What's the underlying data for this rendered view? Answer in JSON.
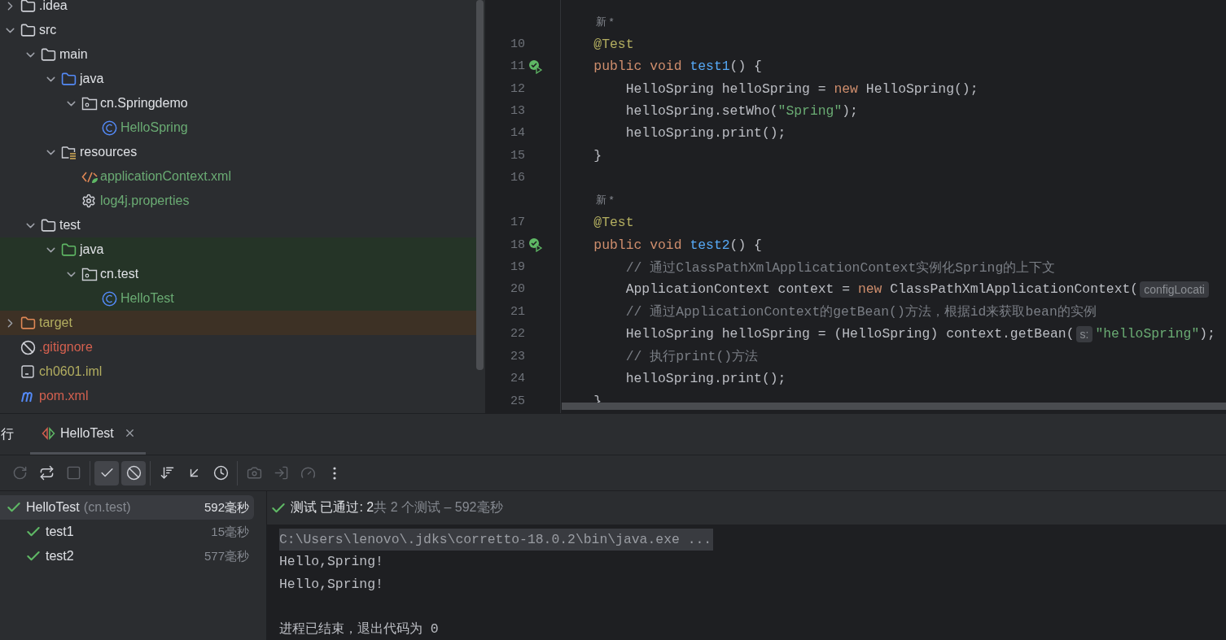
{
  "project_tree": [
    {
      "name": ".idea",
      "kind": "folder",
      "expanded": false,
      "color": "#dfe1e5"
    },
    {
      "name": "src",
      "kind": "folder",
      "expanded": true,
      "color": "#dfe1e5",
      "children": [
        {
          "name": "main",
          "kind": "folder",
          "expanded": true,
          "color": "#dfe1e5",
          "children": [
            {
              "name": "java",
              "kind": "source-folder",
              "expanded": true,
              "color": "#dfe1e5",
              "children": [
                {
                  "name": "cn.Springdemo",
                  "kind": "package",
                  "expanded": true,
                  "color": "#dfe1e5",
                  "children": [
                    {
                      "name": "HelloSpring",
                      "kind": "class",
                      "color": "#6aab73"
                    }
                  ]
                }
              ]
            },
            {
              "name": "resources",
              "kind": "resource-folder",
              "expanded": true,
              "color": "#dfe1e5",
              "children": [
                {
                  "name": "applicationContext.xml",
                  "kind": "xml",
                  "color": "#6aab73"
                },
                {
                  "name": "log4j.properties",
                  "kind": "properties",
                  "color": "#6aab73"
                }
              ]
            }
          ]
        },
        {
          "name": "test",
          "kind": "folder",
          "expanded": true,
          "color": "#dfe1e5",
          "children": [
            {
              "name": "java",
              "kind": "test-folder",
              "expanded": true,
              "color": "#dfe1e5",
              "test_scope": true,
              "children": [
                {
                  "name": "cn.test",
                  "kind": "package",
                  "expanded": true,
                  "color": "#dfe1e5",
                  "test_scope": true,
                  "children": [
                    {
                      "name": "HelloTest",
                      "kind": "class",
                      "color": "#6aab73",
                      "test_scope": true
                    }
                  ]
                }
              ]
            }
          ]
        }
      ]
    },
    {
      "name": "target",
      "kind": "excluded-folder",
      "expanded": false,
      "color": "#b3ae60",
      "excluded": true
    },
    {
      "name": ".gitignore",
      "kind": "ignore",
      "color": "#d3604f"
    },
    {
      "name": "ch0601.iml",
      "kind": "module",
      "color": "#b3ae60"
    },
    {
      "name": "pom.xml",
      "kind": "maven",
      "color": "#d3604f"
    }
  ],
  "editor": {
    "lines": [
      {
        "kind": "hint",
        "text": "新 *"
      },
      {
        "kind": "code",
        "number": "10",
        "segments": [
          {
            "text": "    @Test",
            "kind": "annotation"
          }
        ]
      },
      {
        "kind": "code",
        "number": "11",
        "passed": true,
        "segments": [
          {
            "text": "    public void ",
            "kind": "keyword"
          },
          {
            "text": "test1",
            "kind": "method"
          },
          {
            "text": "() {",
            "kind": "plain"
          }
        ]
      },
      {
        "kind": "code",
        "number": "12",
        "segments": [
          {
            "text": "        HelloSpring helloSpring = ",
            "kind": "plain"
          },
          {
            "text": "new",
            "kind": "keyword"
          },
          {
            "text": " HelloSpring();",
            "kind": "plain"
          }
        ]
      },
      {
        "kind": "code",
        "number": "13",
        "segments": [
          {
            "text": "        helloSpring.setWho(",
            "kind": "plain"
          },
          {
            "text": "\"Spring\"",
            "kind": "string"
          },
          {
            "text": ");",
            "kind": "plain"
          }
        ]
      },
      {
        "kind": "code",
        "number": "14",
        "segments": [
          {
            "text": "        helloSpring.print();",
            "kind": "plain"
          }
        ]
      },
      {
        "kind": "code",
        "number": "15",
        "segments": [
          {
            "text": "    }",
            "kind": "plain"
          }
        ]
      },
      {
        "kind": "code",
        "number": "16"
      },
      {
        "kind": "hint",
        "text": "新 *"
      },
      {
        "kind": "code",
        "number": "17",
        "segments": [
          {
            "text": "    @Test",
            "kind": "annotation"
          }
        ]
      },
      {
        "kind": "code",
        "number": "18",
        "passed": true,
        "segments": [
          {
            "text": "    public void ",
            "kind": "keyword"
          },
          {
            "text": "test2",
            "kind": "method"
          },
          {
            "text": "() {",
            "kind": "plain"
          }
        ]
      },
      {
        "kind": "code",
        "number": "19",
        "segments": [
          {
            "text": "        // 通过ClassPathXmlApplicationContext实例化Spring的上下文",
            "kind": "comment"
          }
        ]
      },
      {
        "kind": "code",
        "number": "20",
        "segments": [
          {
            "text": "        ApplicationContext context = ",
            "kind": "plain"
          },
          {
            "text": "new",
            "kind": "keyword"
          },
          {
            "text": " ClassPathXmlApplicationContext(",
            "kind": "plain"
          },
          {
            "text": "configLocati",
            "kind": "param-hint"
          }
        ]
      },
      {
        "kind": "code",
        "number": "21",
        "segments": [
          {
            "text": "        // 通过ApplicationContext的getBean()方法，根据id来获取bean的实例",
            "kind": "comment"
          }
        ]
      },
      {
        "kind": "code",
        "number": "22",
        "segments": [
          {
            "text": "        HelloSpring helloSpring = (HelloSpring) context.getBean(",
            "kind": "plain"
          },
          {
            "text": "s:",
            "kind": "param-hint"
          },
          {
            "text": "\"helloSpring\"",
            "kind": "string"
          },
          {
            "text": ");",
            "kind": "plain"
          }
        ]
      },
      {
        "kind": "code",
        "number": "23",
        "segments": [
          {
            "text": "        // 执行print()方法",
            "kind": "comment"
          }
        ]
      },
      {
        "kind": "code",
        "number": "24",
        "segments": [
          {
            "text": "        helloSpring.print();",
            "kind": "plain"
          }
        ]
      },
      {
        "kind": "code",
        "number": "25",
        "segments": [
          {
            "text": "    }",
            "kind": "plain"
          }
        ]
      }
    ]
  },
  "run_panel": {
    "title": "行",
    "tabs": [
      {
        "label": "HelloTest",
        "selected": true
      }
    ],
    "toolbar": [
      [
        {
          "selected": false,
          "disabled": true
        },
        {
          "selected": false,
          "disabled": false
        },
        {
          "selected": false,
          "disabled": true
        }
      ],
      [
        {
          "selected": true,
          "disabled": false
        },
        {
          "selected": true,
          "disabled": false
        }
      ],
      [
        {
          "selected": false,
          "disabled": false
        },
        {
          "selected": false,
          "disabled": false
        },
        {
          "selected": false,
          "disabled": false
        }
      ],
      [
        {
          "selected": false,
          "disabled": true
        },
        {
          "selected": false,
          "disabled": true
        },
        {
          "selected": false,
          "disabled": true
        },
        {
          "selected": false,
          "disabled": false
        }
      ]
    ],
    "tests": [
      {
        "name": "HelloTest",
        "package": "(cn.test)",
        "time": "592毫秒",
        "passed": true,
        "selected": true,
        "children": [
          {
            "name": "test1",
            "time": "15毫秒",
            "passed": true,
            "selected": false
          },
          {
            "name": "test2",
            "time": "577毫秒",
            "passed": true,
            "selected": false
          }
        ]
      }
    ],
    "summary": {
      "passed": true,
      "result": "测试 已通过: 2",
      "detail": "共 2 个测试 – 592毫秒"
    },
    "console": [
      {
        "kind": "command",
        "text": "C:\\Users\\lenovo\\.jdks\\corretto-18.0.2\\bin\\java.exe ..."
      },
      {
        "kind": "output",
        "text": "Hello,Spring!"
      },
      {
        "kind": "output",
        "text": "Hello,Spring!"
      },
      {
        "kind": "blank"
      },
      {
        "kind": "output",
        "text": "进程已结束，退出代码为 0"
      }
    ]
  }
}
